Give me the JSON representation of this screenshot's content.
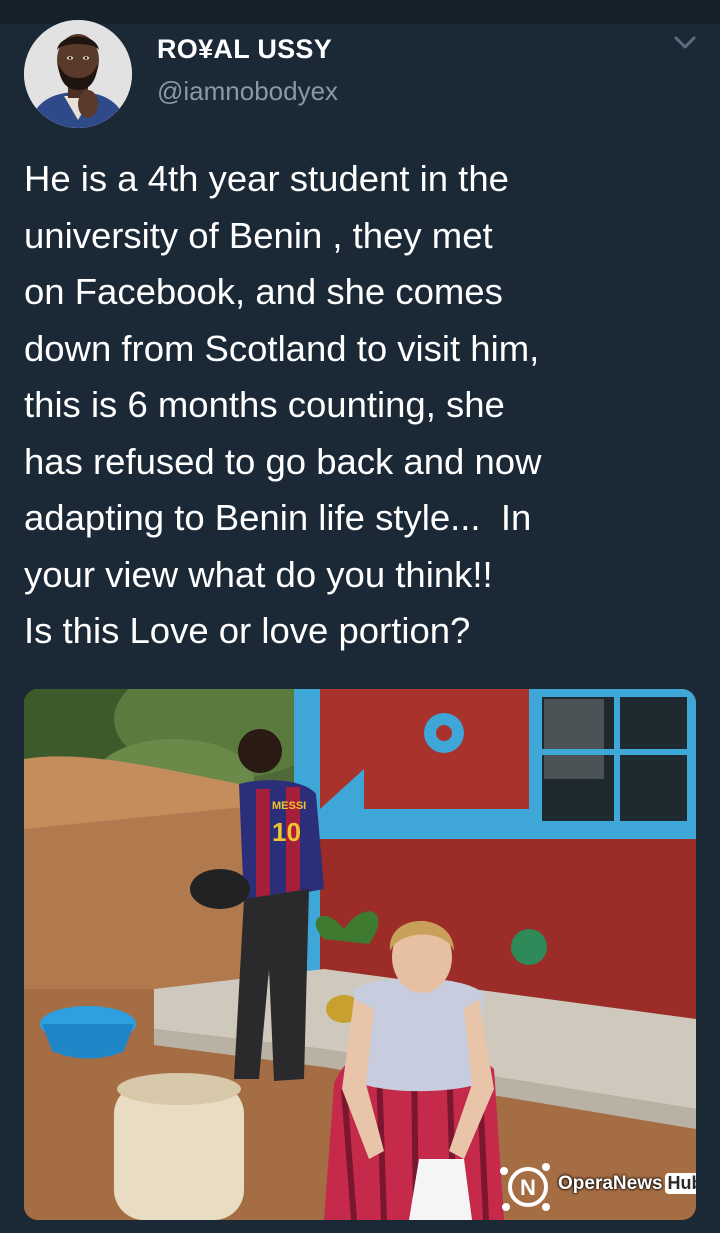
{
  "tweet": {
    "author": {
      "display_name": "RO¥AL USSY",
      "handle": "@iamnobodyex"
    },
    "text_lines": [
      "He is a 4th year student in the",
      "university of Benin , they met",
      "on Facebook, and she comes",
      "down from Scotland to visit him,",
      "this is 6 months counting, she",
      "has refused to go back and now",
      "adapting to Benin life style...  In",
      "your view what do you think!!",
      "Is this Love or love portion?"
    ],
    "menu_icon": "chevron-down-icon"
  },
  "media": {
    "jersey_name": "MESSI",
    "jersey_number": "10",
    "watermark": {
      "brand": "OperaNews",
      "badge": "Hub"
    }
  },
  "colors": {
    "background": "#1b2836",
    "text_primary": "#ffffff",
    "text_secondary": "#8899a6"
  }
}
